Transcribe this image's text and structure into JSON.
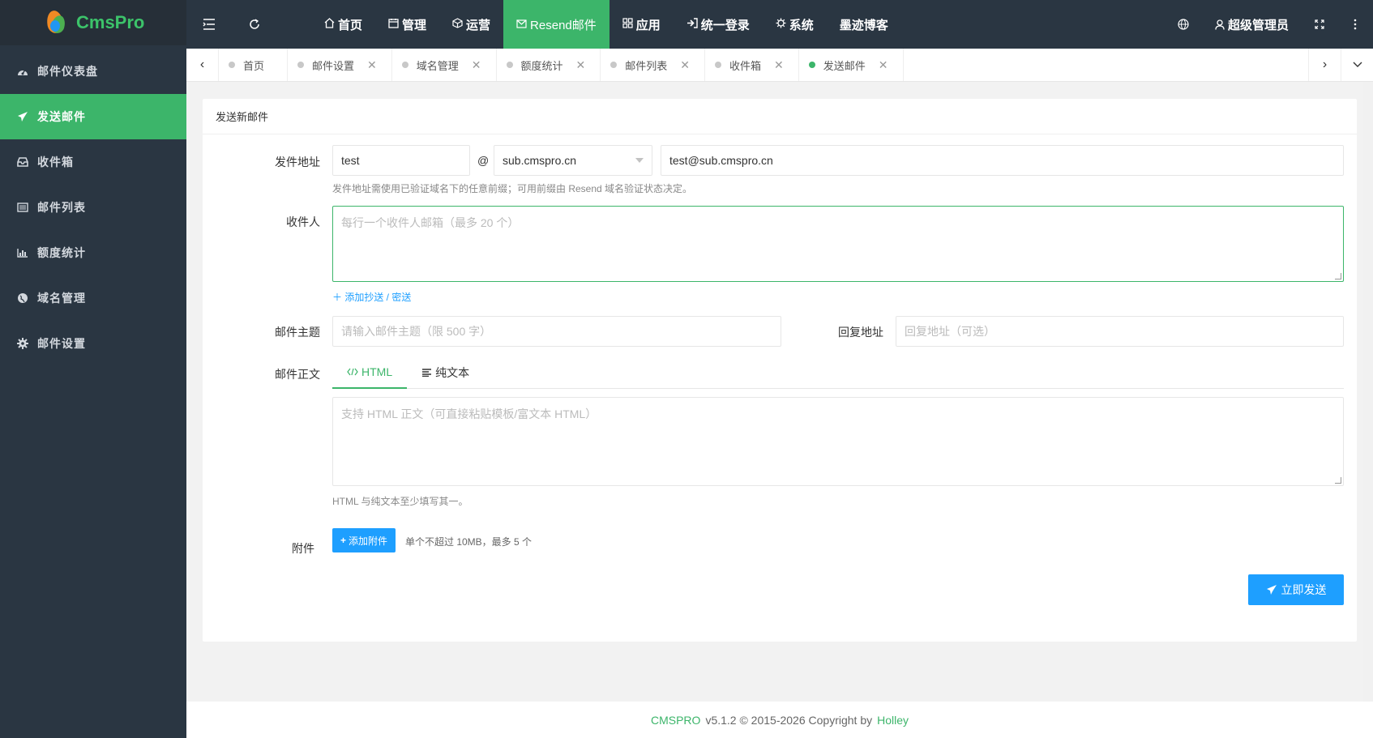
{
  "logo": {
    "text": "CmsPro"
  },
  "sidebar": {
    "items": [
      {
        "label": "邮件仪表盘",
        "icon": "dashboard-icon"
      },
      {
        "label": "发送邮件",
        "icon": "paper-plane-icon",
        "active": true
      },
      {
        "label": "收件箱",
        "icon": "inbox-icon"
      },
      {
        "label": "邮件列表",
        "icon": "list-icon"
      },
      {
        "label": "额度统计",
        "icon": "bar-chart-icon"
      },
      {
        "label": "域名管理",
        "icon": "globe-icon"
      },
      {
        "label": "邮件设置",
        "icon": "gear-icon"
      }
    ]
  },
  "topnav": {
    "items": [
      {
        "label": "首页",
        "icon": "home-icon"
      },
      {
        "label": "管理",
        "icon": "calendar-icon"
      },
      {
        "label": "运营",
        "icon": "cube-icon"
      },
      {
        "label": "Resend邮件",
        "icon": "mail-icon",
        "active": true
      },
      {
        "label": "应用",
        "icon": "apps-icon"
      },
      {
        "label": "统一登录",
        "icon": "login-icon"
      },
      {
        "label": "系统",
        "icon": "gear-icon"
      },
      {
        "label": "墨迹博客",
        "icon": ""
      }
    ],
    "user": "超级管理员"
  },
  "tabs": [
    {
      "label": "首页",
      "closable": false
    },
    {
      "label": "邮件设置",
      "closable": true
    },
    {
      "label": "域名管理",
      "closable": true
    },
    {
      "label": "额度统计",
      "closable": true
    },
    {
      "label": "邮件列表",
      "closable": true
    },
    {
      "label": "收件箱",
      "closable": true
    },
    {
      "label": "发送邮件",
      "closable": true,
      "active": true
    }
  ],
  "form": {
    "card_title": "发送新邮件",
    "from_label": "发件地址",
    "from_prefix": "test",
    "at": "@",
    "from_domain": "sub.cmspro.cn",
    "from_full": "test@sub.cmspro.cn",
    "from_hint": "发件地址需使用已验证域名下的任意前缀；可用前缀由 Resend 域名验证状态决定。",
    "to_label": "收件人",
    "to_placeholder": "每行一个收件人邮箱（最多 20 个）",
    "add_cc": "＋ 添加抄送 / 密送",
    "subject_label": "邮件主题",
    "subject_placeholder": "请输入邮件主题（限 500 字）",
    "reply_label": "回复地址",
    "reply_placeholder": "回复地址（可选）",
    "body_label": "邮件正文",
    "tab_html": "HTML",
    "tab_text": "纯文本",
    "body_placeholder": "支持 HTML 正文（可直接粘贴模板/富文本 HTML）",
    "body_hint": "HTML 与纯文本至少填写其一。",
    "attach_label": "附件",
    "attach_button": "添加附件",
    "attach_hint": "单个不超过 10MB，最多 5 个",
    "send_button": "立即发送"
  },
  "footer": {
    "brand": "CMSPRO",
    "text": "v5.1.2 © 2015-2026 Copyright by",
    "author": "Holley"
  },
  "colors": {
    "accent": "#3cb56a",
    "sidebar": "#2a3642",
    "blue": "#1e9fff"
  }
}
